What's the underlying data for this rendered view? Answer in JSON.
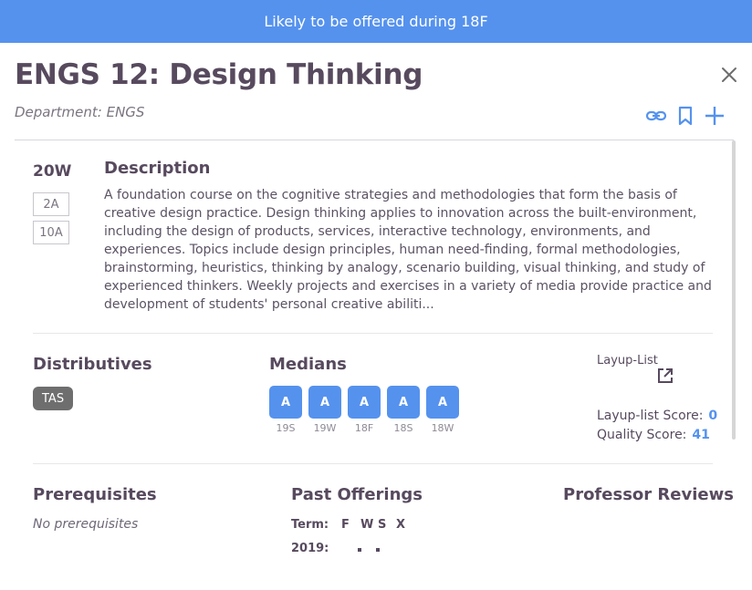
{
  "banner": "Likely to be offered during 18F",
  "course": {
    "title": "ENGS 12: Design Thinking",
    "department": "Department: ENGS"
  },
  "icons": {
    "close": "close-icon",
    "link": "link-icon",
    "bookmark": "bookmark-icon",
    "add": "plus-icon",
    "external": "external-link-icon"
  },
  "colors": {
    "accent": "#5592ee",
    "text": "#574a5e",
    "chip": "#6e6e6e"
  },
  "offering": {
    "term": "20W",
    "periods": [
      "2A",
      "10A"
    ]
  },
  "description": {
    "heading": "Description",
    "text": "A foundation course on the cognitive strategies and methodologies that form the basis of creative design practice. Design thinking applies to innovation across the built-environment, including the design of products, services, interactive technology, environments, and experiences. Topics include design principles, human need-finding, formal methodologies, brainstorming, heuristics, thinking by analogy, scenario building, visual thinking, and study of experienced thinkers. Weekly projects and exercises in a variety of media provide practice and development of students' personal creative abiliti..."
  },
  "distributives": {
    "heading": "Distributives",
    "tags": [
      "TAS"
    ]
  },
  "medians": {
    "heading": "Medians",
    "items": [
      {
        "grade": "A",
        "term": "19S"
      },
      {
        "grade": "A",
        "term": "19W"
      },
      {
        "grade": "A",
        "term": "18F"
      },
      {
        "grade": "A",
        "term": "18S"
      },
      {
        "grade": "A",
        "term": "18W"
      }
    ]
  },
  "layup": {
    "label": "Layup-List",
    "score_label": "Layup-list Score:",
    "score": "0",
    "quality_label": "Quality Score:",
    "quality": "41"
  },
  "prerequisites": {
    "heading": "Prerequisites",
    "text": "No prerequisites"
  },
  "past_offerings": {
    "heading": "Past Offerings",
    "term_label": "Term:",
    "columns": [
      "F",
      "W",
      "S",
      "X"
    ],
    "rows": [
      {
        "year": "2019:",
        "marks": [
          false,
          true,
          true,
          false
        ]
      }
    ]
  },
  "professor_reviews": {
    "heading": "Professor Reviews"
  }
}
